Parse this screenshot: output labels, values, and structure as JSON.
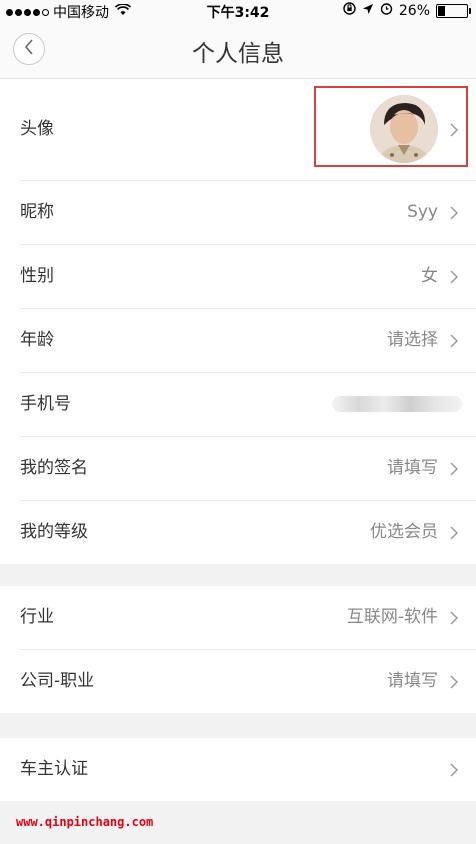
{
  "status": {
    "carrier": "中国移动",
    "time": "下午3:42",
    "battery_text": "26%",
    "battery_level": 0.26,
    "icons": [
      "signal-dots-icon",
      "wifi-icon",
      "orientation-lock-icon",
      "location-icon",
      "alarm-icon",
      "battery-icon"
    ]
  },
  "nav": {
    "title": "个人信息",
    "back_icon": "chevron-left-icon"
  },
  "profile": {
    "avatar_label": "头像",
    "nickname_label": "昵称",
    "nickname_value": "Syy",
    "gender_label": "性别",
    "gender_value": "女",
    "age_label": "年龄",
    "age_value": "请选择",
    "phone_label": "手机号",
    "signature_label": "我的签名",
    "signature_value": "请填写",
    "level_label": "我的等级",
    "level_value": "优选会员"
  },
  "work": {
    "industry_label": "行业",
    "industry_value": "互联网-软件",
    "company_label": "公司-职业",
    "company_value": "请填写"
  },
  "car": {
    "owner_label": "车主认证"
  },
  "watermark": "www.qinpinchang.com",
  "colors": {
    "highlight": "#d94040",
    "watermark": "#e60012",
    "background": "#f2f2f2"
  }
}
